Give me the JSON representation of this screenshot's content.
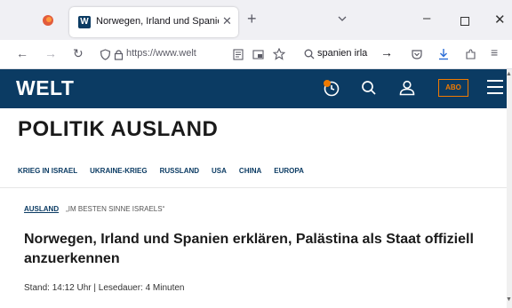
{
  "browser": {
    "tab": {
      "favicon_letter": "W",
      "title": "Norwegen, Irland und Spanien",
      "close_glyph": "✕"
    },
    "new_tab_glyph": "+",
    "window": {
      "minimize_glyph": "–",
      "close_glyph": "✕"
    },
    "nav": {
      "back_glyph": "←",
      "forward_glyph": "→",
      "reload_glyph": "↻",
      "url": "https://www.welt",
      "search_text": "spanien irla",
      "search_go_glyph": "→",
      "menu_glyph": "≡"
    }
  },
  "site": {
    "logo": "WELT",
    "abo_label": "ABO",
    "accent_color": "#0b3b63",
    "abo_color": "#f07a00"
  },
  "page": {
    "section_title": "POLITIK AUSLAND",
    "subnav": [
      "KRIEG IN ISRAEL",
      "UKRAINE-KRIEG",
      "RUSSLAND",
      "USA",
      "CHINA",
      "EUROPA"
    ],
    "article": {
      "topic": "AUSLAND",
      "quote": "„IM BESTEN SINNE ISRAELS“",
      "headline": "Norwegen, Irland und Spanien erklären, Palästina als Staat offiziell anzuerkennen",
      "meta": "Stand: 14:12 Uhr | Lesedauer: 4 Minuten"
    }
  }
}
